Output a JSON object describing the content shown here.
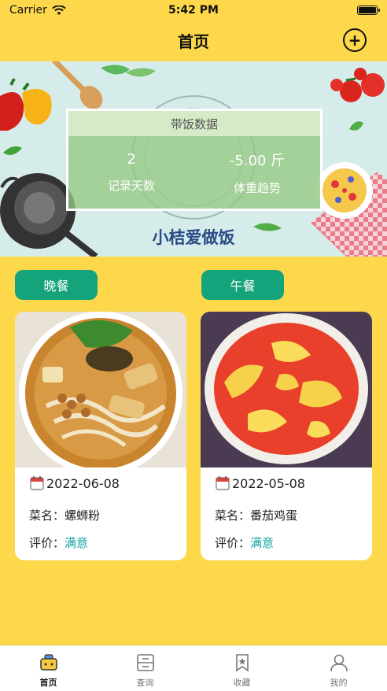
{
  "status_bar": {
    "carrier": "Carrier",
    "time": "5:42 PM",
    "battery_level": 1.0
  },
  "nav": {
    "title": "首页",
    "add_icon": "plus-circle-icon"
  },
  "banner": {
    "panel_title": "带饭数据",
    "stats": [
      {
        "value": "2",
        "label": "记录天数"
      },
      {
        "value": "-5.00 斤",
        "label": "体重趋势"
      }
    ],
    "brand": "小桔爱做饭"
  },
  "meals": [
    {
      "tag": "晚餐",
      "date": "2022-06-08",
      "dish_label": "菜名：",
      "dish": "螺蛳粉",
      "rating_label": "评价：",
      "rating": "满意"
    },
    {
      "tag": "午餐",
      "date": "2022-05-08",
      "dish_label": "菜名：",
      "dish": "番茄鸡蛋",
      "rating_label": "评价：",
      "rating": "满意"
    }
  ],
  "tabs": [
    {
      "label": "首页",
      "icon": "home-pot-icon",
      "active": true
    },
    {
      "label": "查询",
      "icon": "drawer-icon",
      "active": false
    },
    {
      "label": "收藏",
      "icon": "bookmark-star-icon",
      "active": false
    },
    {
      "label": "我的",
      "icon": "person-icon",
      "active": false
    }
  ],
  "colors": {
    "background": "#FDD84A",
    "accent": "#14A37A",
    "rating": "#14A3A0",
    "brand_text": "#2B4A86"
  }
}
